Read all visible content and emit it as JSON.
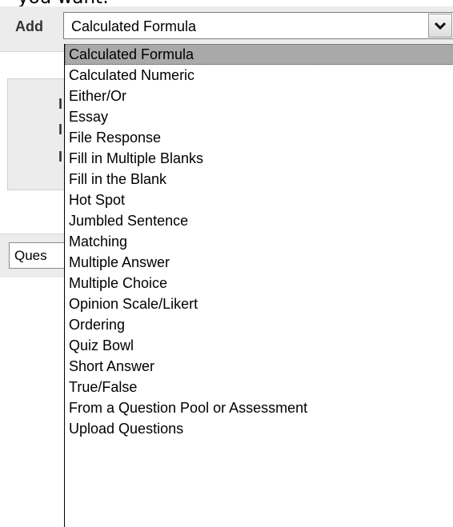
{
  "top_text": "you want:",
  "add_label": "Add",
  "select": {
    "value": "Calculated Formula",
    "arrow_icon": "chevron-down-icon"
  },
  "background_panel_letters": [
    "I",
    "I",
    "I"
  ],
  "filter_field_value": "Ques",
  "dropdown": {
    "selected_index": 0,
    "options": [
      "Calculated Formula",
      "Calculated Numeric",
      "Either/Or",
      "Essay",
      "File Response",
      "Fill in Multiple Blanks",
      "Fill in the Blank",
      "Hot Spot",
      "Jumbled Sentence",
      "Matching",
      "Multiple Answer",
      "Multiple Choice",
      "Opinion Scale/Likert",
      "Ordering",
      "Quiz Bowl",
      "Short Answer",
      "True/False",
      "From a Question Pool or Assessment",
      "Upload Questions"
    ]
  },
  "colors": {
    "panel_gray": "#ececec",
    "selected_highlight": "#a9a9a9"
  }
}
